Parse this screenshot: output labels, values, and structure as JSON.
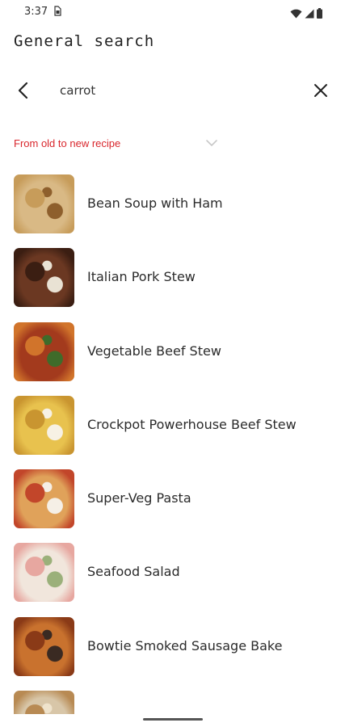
{
  "status": {
    "time": "3:37",
    "sim_icon": "sim-card-icon",
    "icons": [
      "wifi-icon",
      "signal-icon",
      "battery-icon"
    ]
  },
  "page": {
    "title": "General search"
  },
  "search": {
    "value": "carrot",
    "back_icon": "back-arrow-icon",
    "clear_icon": "close-icon"
  },
  "sort": {
    "label": "From old to new recipe",
    "accent": "#d9262c"
  },
  "recipes": [
    {
      "name": "Bean Soup with Ham",
      "colors": [
        "#d9b985",
        "#c79c5a",
        "#8e5f2c"
      ]
    },
    {
      "name": "Italian Pork Stew",
      "colors": [
        "#6b3822",
        "#3b1e12",
        "#e9e2d4"
      ]
    },
    {
      "name": "Vegetable Beef Stew",
      "colors": [
        "#a33a1d",
        "#d1742b",
        "#3f6b2a"
      ]
    },
    {
      "name": "Crockpot Powerhouse Beef Stew",
      "colors": [
        "#e8c24e",
        "#c99530",
        "#f7f1e4"
      ]
    },
    {
      "name": "Super-Veg Pasta",
      "colors": [
        "#e0a25a",
        "#c2462a",
        "#f5efe6"
      ]
    },
    {
      "name": "Seafood Salad",
      "colors": [
        "#f1e6dc",
        "#e7a7a0",
        "#9bb07a"
      ]
    },
    {
      "name": "Bowtie Smoked Sausage Bake",
      "colors": [
        "#c9722e",
        "#8a3a17",
        "#3a2a22"
      ]
    },
    {
      "name": "",
      "colors": [
        "#d8c6a8",
        "#b88a53",
        "#efe3cc"
      ]
    }
  ]
}
